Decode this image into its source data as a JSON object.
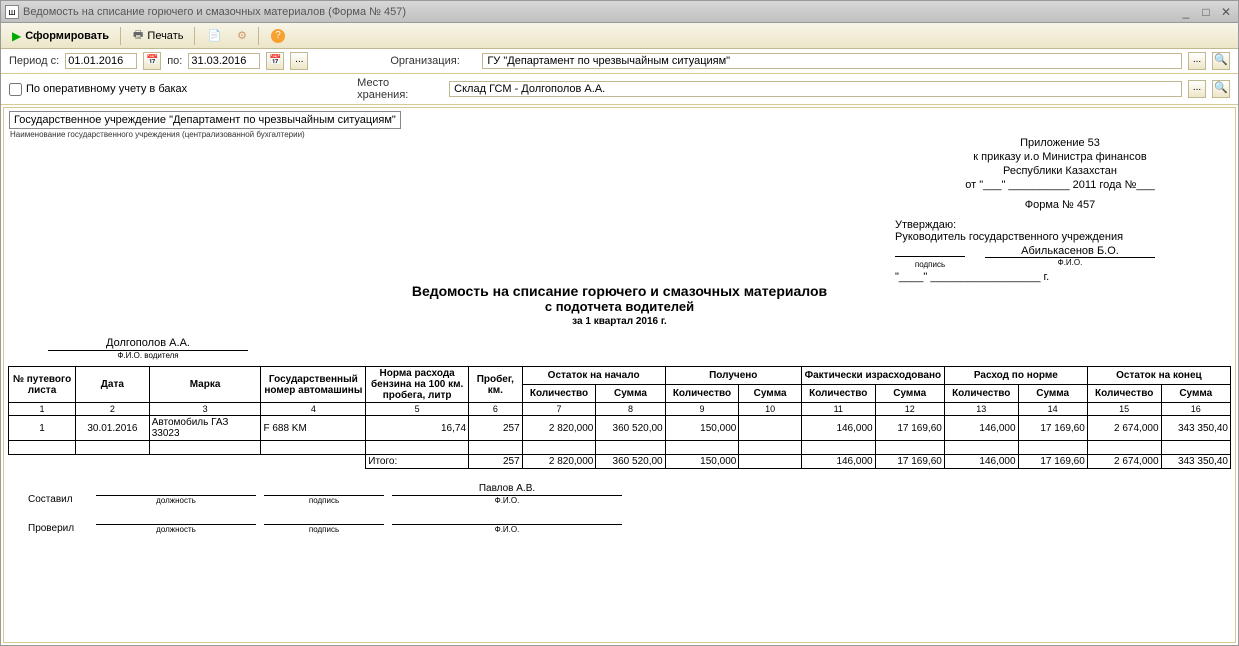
{
  "window": {
    "title": "Ведомость на списание горючего и смазочных материалов (Форма № 457)"
  },
  "toolbar": {
    "form_btn": "Сформировать",
    "print_btn": "Печать"
  },
  "filters": {
    "period_from_lbl": "Период с:",
    "period_from": "01.01.2016",
    "period_to_lbl": "по:",
    "period_to": "31.03.2016",
    "org_lbl": "Организация:",
    "org_value": "ГУ \"Департамент по чрезвычайным ситуациям\"",
    "checkbox_lbl": "По оперативному учету в баках",
    "storage_lbl": "Место хранения:",
    "storage_value": "Склад ГСМ - Долгополов А.А."
  },
  "doc": {
    "org_name": "Государственное учреждение \"Департамент по чрезвычайным ситуациям\"",
    "org_caption": "Наименование государственного учреждения (централизованной бухгалтерии)",
    "appendix": "Приложение 53",
    "appendix_to1": "к приказу и.о Министра финансов",
    "appendix_to2": "Республики Казахстан",
    "appendix_date": "от \"___\" __________ 2011 года №___",
    "form_no": "Форма № 457",
    "approve": "Утверждаю:",
    "approve_position": "Руководитель государственного учреждения",
    "approve_name": "Абилькасенов Б.О.",
    "sig_cap": "подпись",
    "fio_cap": "Ф.И.О.",
    "date_line": "\"____\" __________________ г.",
    "title1": "Ведомость на списание горючего и смазочных материалов",
    "title2": "с подотчета водителей",
    "period": "за 1 квартал 2016 г.",
    "driver": "Долгополов А.А.",
    "driver_cap": "Ф.И.О. водителя"
  },
  "table": {
    "headers": {
      "c1": "№ путевого листа",
      "c2": "Дата",
      "c3": "Марка",
      "c4": "Государственный номер автомашины",
      "c5": "Норма расхода бензина на 100 км. пробега, литр",
      "c6": "Пробег, км.",
      "g7": "Остаток на начало",
      "g9": "Получено",
      "g11": "Фактически израсходовано",
      "g13": "Расход по норме",
      "g15": "Остаток на конец",
      "qty": "Количество",
      "sum": "Сумма",
      "qty_o": "Количество"
    },
    "colnums": [
      "1",
      "2",
      "3",
      "4",
      "5",
      "6",
      "7",
      "8",
      "9",
      "10",
      "11",
      "12",
      "13",
      "14",
      "15",
      "16"
    ],
    "rows": [
      {
        "c1": "1",
        "c2": "30.01.2016",
        "c3": "Автомобиль ГАЗ 33023",
        "c4": "F 688 KM",
        "c5": "16,74",
        "c6": "257",
        "c7": "2 820,000",
        "c8": "360 520,00",
        "c9": "150,000",
        "c10": "",
        "c11": "146,000",
        "c12": "17 169,60",
        "c13": "146,000",
        "c14": "17 169,60",
        "c15": "2 674,000",
        "c16": "343 350,40"
      }
    ],
    "total_lbl": "Итого:",
    "total": {
      "c6": "257",
      "c7": "2 820,000",
      "c8": "360 520,00",
      "c9": "150,000",
      "c10": "",
      "c11": "146,000",
      "c12": "17 169,60",
      "c13": "146,000",
      "c14": "17 169,60",
      "c15": "2 674,000",
      "c16": "343 350,40"
    }
  },
  "footer": {
    "compiled_lbl": "Составил",
    "checked_lbl": "Проверил",
    "position_cap": "должность",
    "sign_cap": "подпись",
    "fio_cap": "Ф.И.О.",
    "compiler_name": "Павлов А.В."
  }
}
